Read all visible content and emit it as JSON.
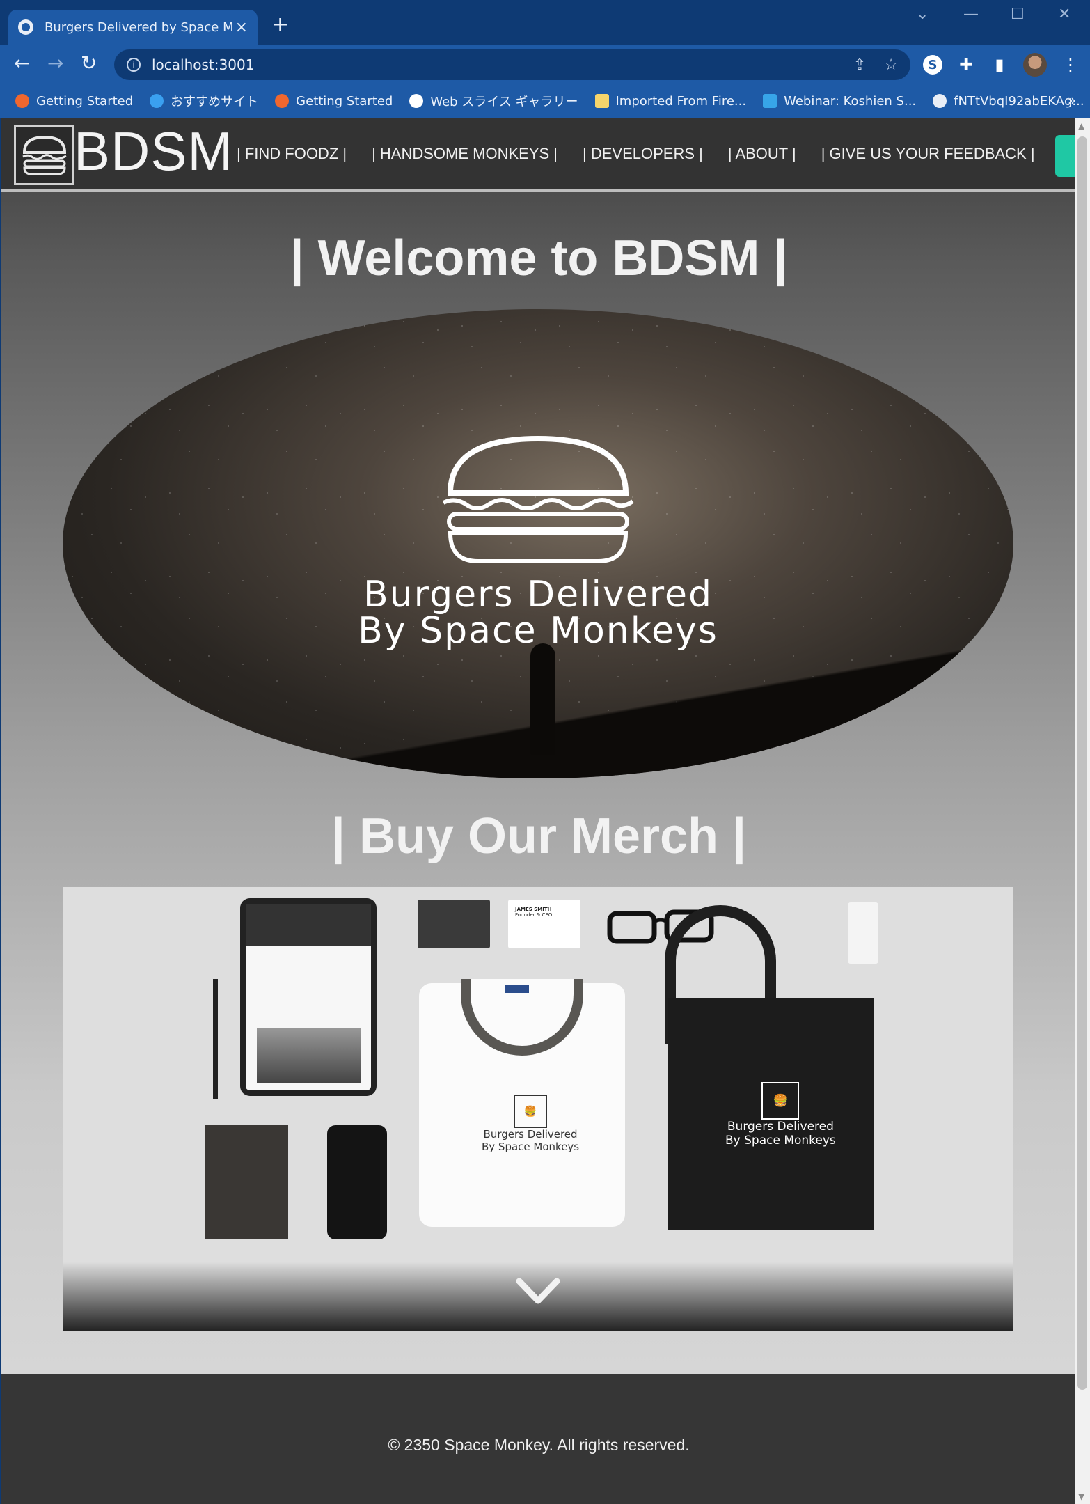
{
  "browser": {
    "tab_title": "Burgers Delivered by Space Monkeys",
    "url": "localhost:3001",
    "bookmarks": [
      {
        "label": "Getting Started",
        "icon": "firefox-icon",
        "color": "#f0672e"
      },
      {
        "label": "おすすめサイト",
        "icon": "bing-icon",
        "color": "#3aa0f0"
      },
      {
        "label": "Getting Started",
        "icon": "firefox-icon",
        "color": "#f0672e"
      },
      {
        "label": "Web スライス ギャラリー",
        "icon": "web-slice-icon",
        "color": "#ffffff"
      },
      {
        "label": "Imported From Fire...",
        "icon": "folder-icon",
        "color": "#f6d56b"
      },
      {
        "label": "Webinar: Koshien S...",
        "icon": "webinar-icon",
        "color": "#37a5e8"
      },
      {
        "label": "fNTtVbqI92abEKAg...",
        "icon": "globe-icon",
        "color": "#e9eef6"
      }
    ]
  },
  "site": {
    "brand": "BDSM",
    "nav": [
      "| FIND FOODZ |",
      "| HANDSOME MONKEYS |",
      "| DEVELOPERS |",
      "| ABOUT |",
      "| GIVE US YOUR FEEDBACK |"
    ],
    "welcome_heading": "| Welcome to BDSM |",
    "hero_tagline_1": "Burgers Delivered",
    "hero_tagline_2": "By Space Monkeys",
    "merch_heading": "| Buy Our Merch |",
    "merch_logo_line_1": "Burgers Delivered",
    "merch_logo_line_2": "By Space Monkeys",
    "card_name": "JAMES SMITH",
    "card_role": "Founder & CEO",
    "footer_text": "© 2350 Space Monkey. All rights reserved."
  },
  "colors": {
    "chrome_dark": "#0e3a74",
    "chrome_light": "#1e5aa6",
    "header_bg": "#333333",
    "accent_edge": "#1fc8a4",
    "footer_bg": "#363636"
  }
}
